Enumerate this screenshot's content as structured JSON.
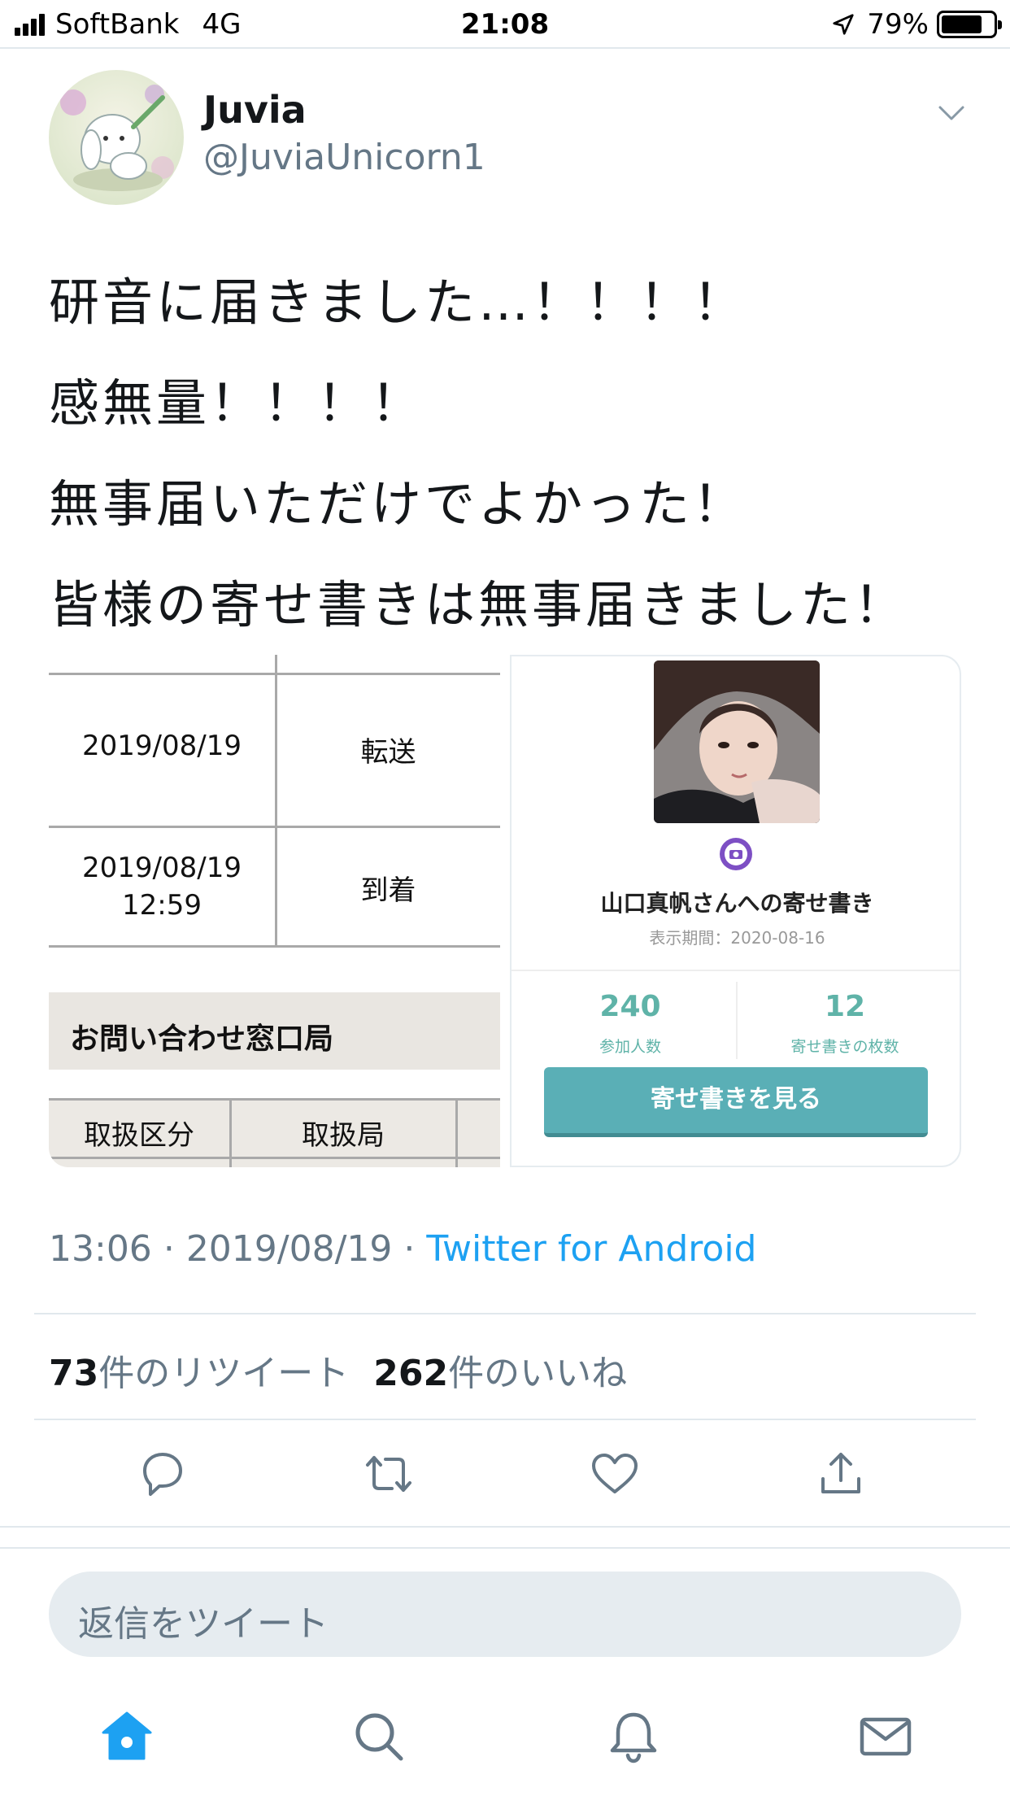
{
  "status_bar": {
    "carrier": "SoftBank",
    "network": "4G",
    "time": "21:08",
    "battery": "79%",
    "battery_level": 0.79
  },
  "tweet": {
    "author": {
      "name": "Juvia",
      "handle": "@JuviaUnicorn1"
    },
    "lines": [
      "研音に届きました…！！！！",
      "感無量！！！！",
      "無事届いただけでよかった！",
      "皆様の寄せ書きは無事届きました！"
    ],
    "meta": {
      "time": "13:06",
      "date": "2019/08/19",
      "separator": "·",
      "source": "Twitter for Android"
    },
    "counts": {
      "retweets": "73",
      "retweets_label": "件のリツイート",
      "likes": "262",
      "likes_label": "件のいいね"
    }
  },
  "media_left": {
    "rows": [
      {
        "date": "2019/08/19",
        "time": "",
        "status": "転送"
      },
      {
        "date": "2019/08/19",
        "time": "12:59",
        "status": "到着"
      }
    ],
    "inquiry_heading": "お問い合わせ窓口局",
    "bottom_headers": [
      "取扱区分",
      "取扱局"
    ]
  },
  "media_right": {
    "title": "山口真帆さんへの寄せ書き",
    "period": "表示期間：2020-08-16",
    "stats": [
      {
        "value": "240",
        "label": "参加人数"
      },
      {
        "value": "12",
        "label": "寄せ書きの枚数"
      }
    ],
    "button": "寄せ書きを見る"
  },
  "reply": {
    "placeholder": "返信をツイート"
  },
  "colors": {
    "link": "#1da1f2",
    "accent_teal": "#5aafb6",
    "muted": "#657786",
    "tab_active": "#1da1f2",
    "tab_inactive": "#657786"
  }
}
